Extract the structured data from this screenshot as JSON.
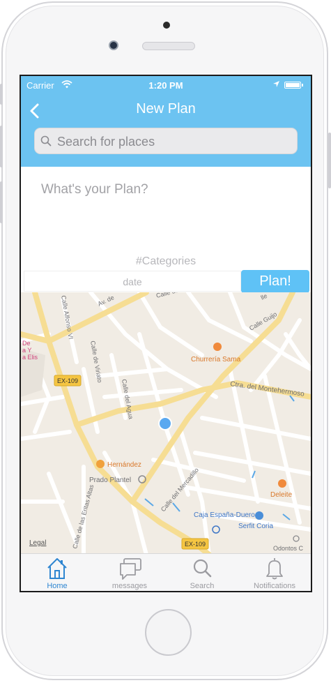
{
  "status_bar": {
    "carrier": "Carrier",
    "time": "1:20 PM"
  },
  "nav": {
    "title": "New Plan"
  },
  "search": {
    "placeholder": "Search for places"
  },
  "plan_input": {
    "placeholder": "What's your Plan?"
  },
  "categories": {
    "label": "#Categories"
  },
  "date_field": {
    "placeholder": "date"
  },
  "plan_button": {
    "label": "Plan!"
  },
  "map": {
    "road_labels": [
      "Av. de",
      "Calle Alfonso VI",
      "Calle de México",
      "Calle Guijo",
      "Ctra. del Montehermoso",
      "Calle de Viriato",
      "Calle del Agua",
      "Calle del Mercadillo",
      "Calle de las Eritas Altas"
    ],
    "route_badges": [
      "EX-109",
      "EX-109"
    ],
    "places": [
      "Churrería Sama",
      "Hernández",
      "Prado Plantel",
      "Deleite",
      "Caja España-Duero",
      "Serfit Coria",
      "Odontos C"
    ],
    "partial_labels": [
      "De",
      "a Y",
      "a Elis",
      "lle"
    ],
    "legal": "Legal"
  },
  "tabs": [
    {
      "label": "Home",
      "icon": "home-icon",
      "active": true
    },
    {
      "label": "messages",
      "icon": "messages-icon",
      "active": false
    },
    {
      "label": "Search",
      "icon": "search-icon",
      "active": false
    },
    {
      "label": "Notifications",
      "icon": "bell-icon",
      "active": false
    }
  ],
  "colors": {
    "accent": "#6cc3f1",
    "button": "#5fc2f6",
    "tab_active": "#2f86d1",
    "tab_inactive": "#9b9ba0"
  }
}
